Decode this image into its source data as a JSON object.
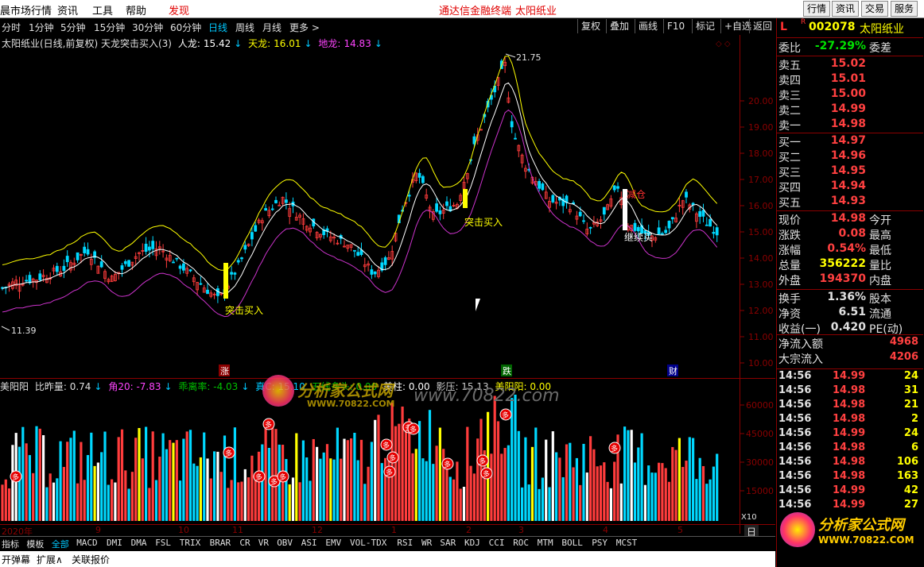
{
  "menu": {
    "items": [
      "晨市场行情",
      "资讯",
      "工具",
      "帮助",
      "发现"
    ],
    "center_title": "通达信金融终端",
    "center_stock": "太阳纸业",
    "right_buttons": [
      "行情",
      "资讯",
      "交易",
      "服务"
    ]
  },
  "periods": [
    "分时",
    "1分钟",
    "5分钟",
    "15分钟",
    "30分钟",
    "60分钟",
    "日线",
    "周线",
    "月线",
    "更多 >"
  ],
  "active_period": "日线",
  "toolbar": [
    "复权",
    "叠加",
    "画线",
    "F10",
    "标记",
    "+自选",
    "返回"
  ],
  "main_legend": {
    "title": "太阳纸业(日线,前复权) 天龙突击买入(3)",
    "renlong_label": "人龙:",
    "renlong": "15.42",
    "tianlong_label": "天龙:",
    "tianlong": "16.01",
    "dilong_label": "地龙:",
    "dilong": "14.83"
  },
  "price_axis": [
    "20.00",
    "19.00",
    "18.00",
    "17.00",
    "16.00",
    "15.00",
    "14.00",
    "13.00",
    "12.00",
    "11.00",
    "10.00"
  ],
  "annotations": {
    "high": "21.75",
    "low": "11.39",
    "buy1": "突击买入",
    "buy2": "突击买入",
    "hold": "继续买",
    "sell": "减仓",
    "markers": {
      "zhang": "涨",
      "die": "跌",
      "cai": "财"
    }
  },
  "vol_legend": {
    "name": "美阳阳",
    "l1": "比昨量: 0.74",
    "l2": "角20: -7.83",
    "l3": "乖离率: -4.03",
    "l4": "真C: 15.10",
    "l5": "五线多头: 0.00",
    "l6": "美柱: 0.00",
    "l7": "影压: 15.13",
    "l8": "美阳阳: 0.00"
  },
  "vol_axis": [
    "60000",
    "45000",
    "30000",
    "15000"
  ],
  "vol_unit": "X10",
  "vol_marker": "多",
  "date_axis": [
    "2020年",
    "9",
    "10",
    "11",
    "12",
    "1",
    "2",
    "3",
    "4",
    "5"
  ],
  "date_right": "日",
  "watermark": {
    "line1": "分析家公式网",
    "line2": "WWW.70822.COM",
    "inline": "www.70822.com"
  },
  "quote": {
    "header_l": "L",
    "header_r": "R",
    "code": "002078",
    "name": "太阳纸业",
    "weibi_label": "委比",
    "weibi": "-27.29%",
    "weicha_label": "委差",
    "asks": [
      {
        "l": "卖五",
        "p": "15.02"
      },
      {
        "l": "卖四",
        "p": "15.01"
      },
      {
        "l": "卖三",
        "p": "15.00"
      },
      {
        "l": "卖二",
        "p": "14.99"
      },
      {
        "l": "卖一",
        "p": "14.98"
      }
    ],
    "bids": [
      {
        "l": "买一",
        "p": "14.97"
      },
      {
        "l": "买二",
        "p": "14.96"
      },
      {
        "l": "买三",
        "p": "14.95"
      },
      {
        "l": "买四",
        "p": "14.94"
      },
      {
        "l": "买五",
        "p": "14.93"
      }
    ],
    "stats": [
      {
        "l": "现价",
        "v": "14.98",
        "l2": "今开",
        "c": "#ff4040"
      },
      {
        "l": "涨跌",
        "v": "0.08",
        "l2": "最高",
        "c": "#ff4040"
      },
      {
        "l": "涨幅",
        "v": "0.54%",
        "l2": "最低",
        "c": "#ff4040"
      },
      {
        "l": "总量",
        "v": "356222",
        "l2": "量比",
        "c": "#ffff00"
      },
      {
        "l": "外盘",
        "v": "194370",
        "l2": "内盘",
        "c": "#ff4040"
      }
    ],
    "stats2": [
      {
        "l": "换手",
        "v": "1.36%",
        "l2": "股本",
        "c": "#e0e0e0"
      },
      {
        "l": "净资",
        "v": "6.51",
        "l2": "流通",
        "c": "#e0e0e0"
      },
      {
        "l": "收益(一)",
        "v": "0.420",
        "l2": "PE(动)",
        "c": "#e0e0e0"
      }
    ],
    "flow": [
      {
        "l": "净流入额",
        "v": "4968"
      },
      {
        "l": "大宗流入",
        "v": "4206"
      }
    ],
    "ticks": [
      {
        "t": "14:56",
        "p": "14.99",
        "v": "24"
      },
      {
        "t": "14:56",
        "p": "14.98",
        "v": "31"
      },
      {
        "t": "14:56",
        "p": "14.98",
        "v": "21"
      },
      {
        "t": "14:56",
        "p": "14.98",
        "v": "2"
      },
      {
        "t": "14:56",
        "p": "14.99",
        "v": "24"
      },
      {
        "t": "14:56",
        "p": "14.98",
        "v": "6"
      },
      {
        "t": "14:56",
        "p": "14.98",
        "v": "106"
      },
      {
        "t": "14:56",
        "p": "14.98",
        "v": "163"
      },
      {
        "t": "14:56",
        "p": "14.99",
        "v": "42"
      },
      {
        "t": "14:56",
        "p": "14.99",
        "v": "27"
      }
    ]
  },
  "tabs": [
    "指标",
    "模板",
    "全部",
    "MACD",
    "DMI",
    "DMA",
    "FSL",
    "TRIX",
    "BRAR",
    "CR",
    "VR",
    "OBV",
    "ASI",
    "EMV",
    "VOL-TDX",
    "RSI",
    "WR",
    "SAR",
    "KDJ",
    "CCI",
    "ROC",
    "MTM",
    "BOLL",
    "PSY",
    "MCST"
  ],
  "active_tab": "全部",
  "status": [
    "开弹幕",
    "扩展∧",
    "关联报价"
  ]
}
